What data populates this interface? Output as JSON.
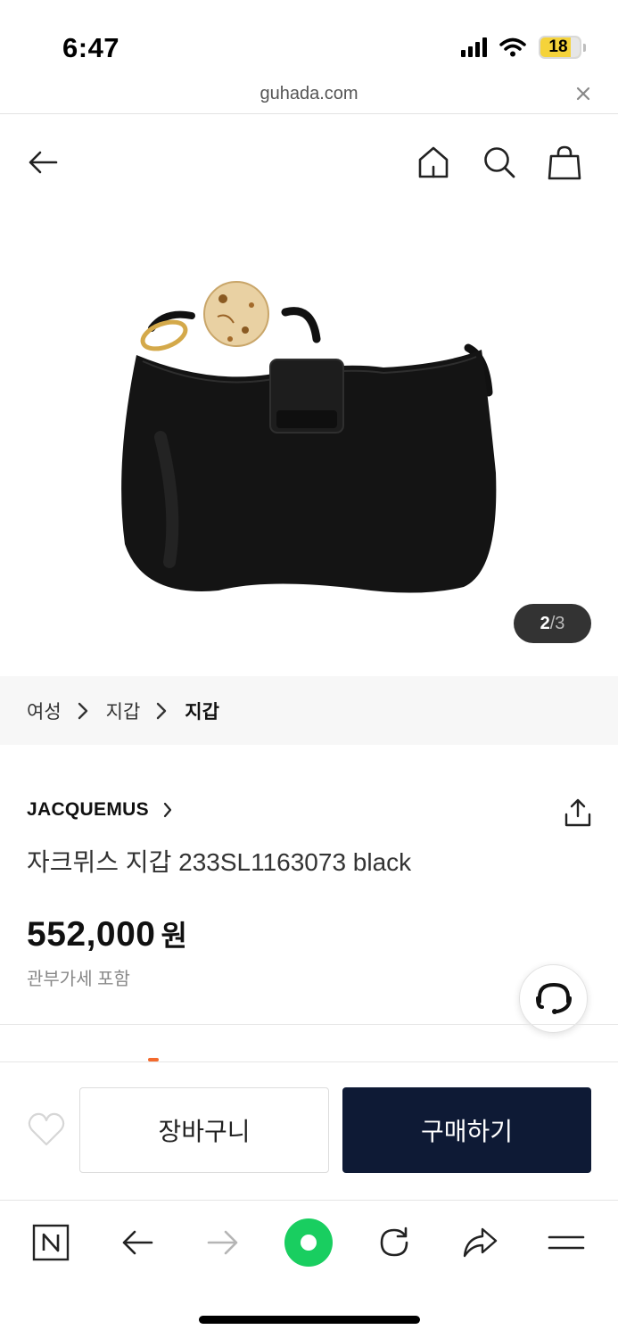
{
  "status_bar": {
    "time": "6:47",
    "battery_level": "18",
    "battery_color": "#f5d33a"
  },
  "browser": {
    "url": "guhada.com",
    "close_icon": "close-icon",
    "toolbar_icons": [
      "naver-n-icon",
      "back-arrow-icon",
      "forward-arrow-icon",
      "green-dot-icon",
      "reload-icon",
      "share-arrow-icon",
      "menu-icon"
    ],
    "green_dot_color": "#19ce60"
  },
  "header": {
    "back_icon": "back-arrow-icon",
    "home_icon": "home-icon",
    "search_icon": "search-icon",
    "cart_icon": "shopping-bag-icon"
  },
  "gallery": {
    "current": "2",
    "separator": "/",
    "total": "3"
  },
  "breadcrumb": {
    "items": [
      "여성",
      "지갑",
      "지갑"
    ]
  },
  "product": {
    "brand": "JACQUEMUS",
    "title": "자크뮈스 지갑 233SL1163073 black",
    "price": "552,000",
    "price_unit": "원",
    "price_note": "관부가세 포함"
  },
  "actions": {
    "cart_label": "장바구니",
    "buy_label": "구매하기",
    "buy_color": "#0e1a35"
  }
}
